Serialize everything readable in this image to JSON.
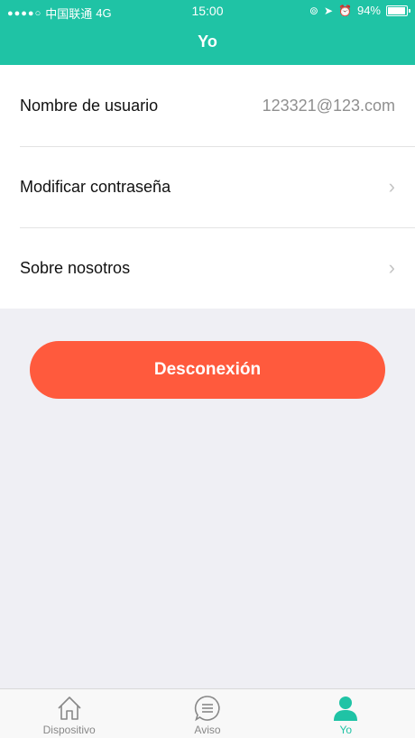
{
  "status": {
    "carrier": "中国联通",
    "network": "4G",
    "time": "15:00",
    "battery": "94%",
    "battery_level": 0.94
  },
  "nav": {
    "title": "Yo"
  },
  "profile": {
    "username_label": "Nombre de usuario",
    "username_value": "123321@123.com",
    "change_password_label": "Modificar contraseña",
    "about_label": "Sobre nosotros"
  },
  "logout_label": "Desconexión",
  "tabs": [
    {
      "label": "Dispositivo",
      "icon": "home-icon",
      "active": false
    },
    {
      "label": "Aviso",
      "icon": "message-icon",
      "active": false
    },
    {
      "label": "Yo",
      "icon": "person-icon",
      "active": true
    }
  ],
  "colors": {
    "primary": "#1fc3a5",
    "danger": "#ff5a3d",
    "background": "#efeff4"
  }
}
